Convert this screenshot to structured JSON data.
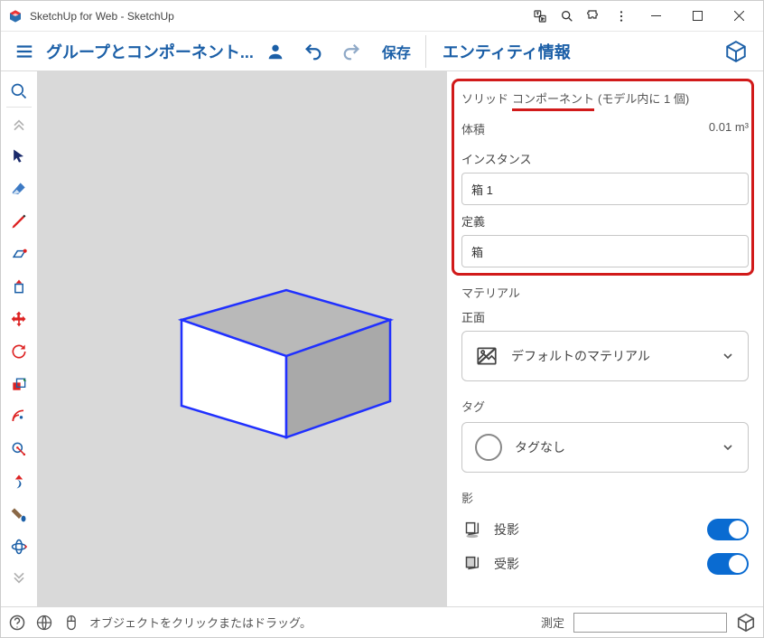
{
  "titlebar": {
    "text": "SketchUp for Web - SketchUp"
  },
  "topbar": {
    "docTitle": "グループとコンポーネント...",
    "save": "保存",
    "panelTitle": "エンティティ情報"
  },
  "entityInfo": {
    "solidPrefix": "ソリッド",
    "solidType": "コンポーネント",
    "solidSuffix": "(モデル内に 1 個)",
    "volumeLabel": "体積",
    "volumeValue": "0.01 m³",
    "instanceLabel": "インスタンス",
    "instanceValue": "箱 1",
    "definitionLabel": "定義",
    "definitionValue": "箱",
    "materialLabel": "マテリアル",
    "faceLabel": "正面",
    "defaultMaterial": "デフォルトのマテリアル",
    "tagLabel": "タグ",
    "tagNone": "タグなし",
    "shadowLabel": "影",
    "castShadow": "投影",
    "receiveShadow": "受影"
  },
  "status": {
    "hint": "オブジェクトをクリックまたはドラッグ。",
    "measureLabel": "測定"
  },
  "tools": {
    "search": "search",
    "collapse": "collapse",
    "select": "select",
    "eraser": "eraser",
    "pencil": "pencil",
    "rect": "rect",
    "pushpull": "pushpull",
    "move": "move",
    "rotate": "rotate",
    "scale": "scale",
    "offset": "offset",
    "tape": "tape",
    "walk": "walk",
    "paint": "paint",
    "orbit": "orbit"
  }
}
